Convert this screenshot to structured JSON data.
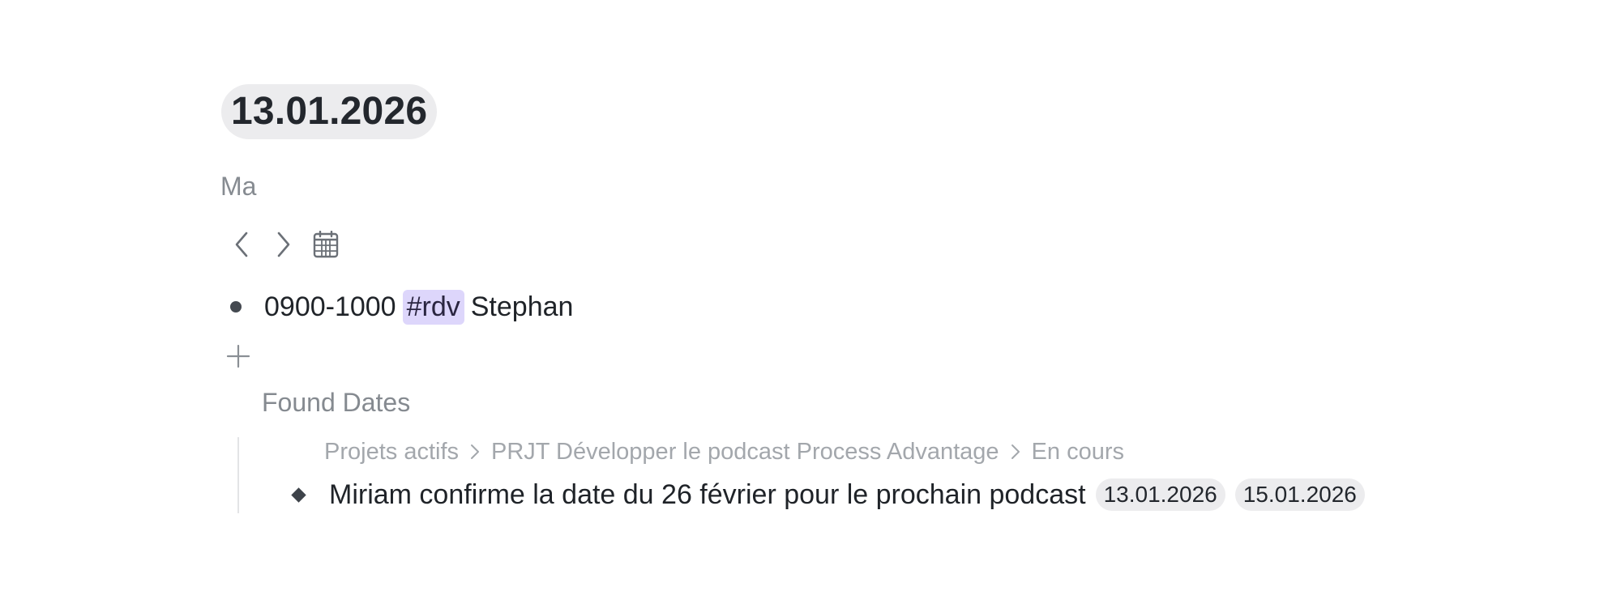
{
  "page": {
    "date_title": "13.01.2026",
    "weekday": "Ma"
  },
  "nav": {
    "prev_icon": "chevron-left-icon",
    "next_icon": "chevron-right-icon",
    "calendar_icon": "calendar-icon"
  },
  "entries": [
    {
      "time": "0900-1000",
      "tag": "#rdv",
      "text": "Stephan"
    }
  ],
  "add_icon": "plus-icon",
  "found_dates": {
    "title": "Found Dates",
    "breadcrumb": [
      "Projets actifs",
      "PRJT Développer le podcast Process Advantage",
      "En cours"
    ],
    "item": {
      "text": "Miriam confirme la date du 26 février pour le prochain podcast",
      "dates": [
        "13.01.2026",
        "15.01.2026"
      ]
    }
  },
  "colors": {
    "tag_bg": "#ddd6fb",
    "chip_bg": "#ececee",
    "muted_text": "#858a90",
    "breadcrumb_text": "#a3a7ac"
  }
}
